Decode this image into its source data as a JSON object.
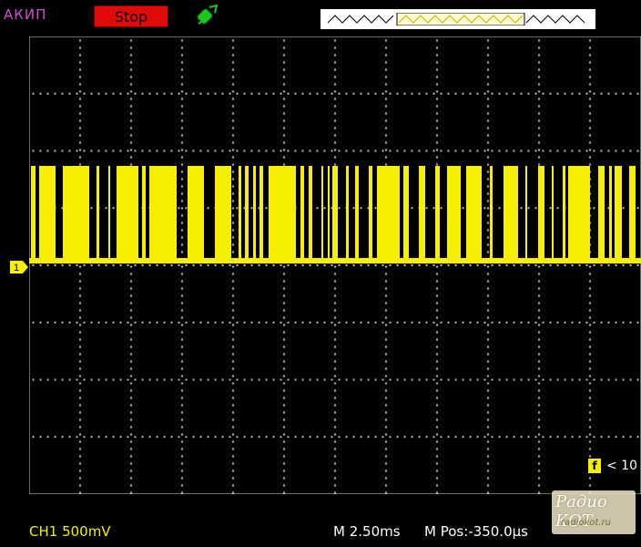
{
  "header": {
    "brand": "АКИП",
    "run_state": "Stop",
    "trigger_icon": "trigger-source-icon",
    "trigger_position_marker": "T"
  },
  "channel": {
    "marker_label": "1",
    "scale_text": "CH1 500mV",
    "color": "#f6ef00"
  },
  "timebase": {
    "scale_text": "M 2.50ms",
    "position_text": "M Pos:-350.0µs"
  },
  "measurement": {
    "freq_icon": "f",
    "freq_text": "< 10"
  },
  "watermark": {
    "title": "Радио КОТ",
    "url": "radiokot.ru"
  },
  "colors": {
    "background": "#000000",
    "grid": "#cfcfcf",
    "trace": "#f6ef00",
    "stop": "#e10a0a",
    "brand": "#d24fd2"
  }
}
